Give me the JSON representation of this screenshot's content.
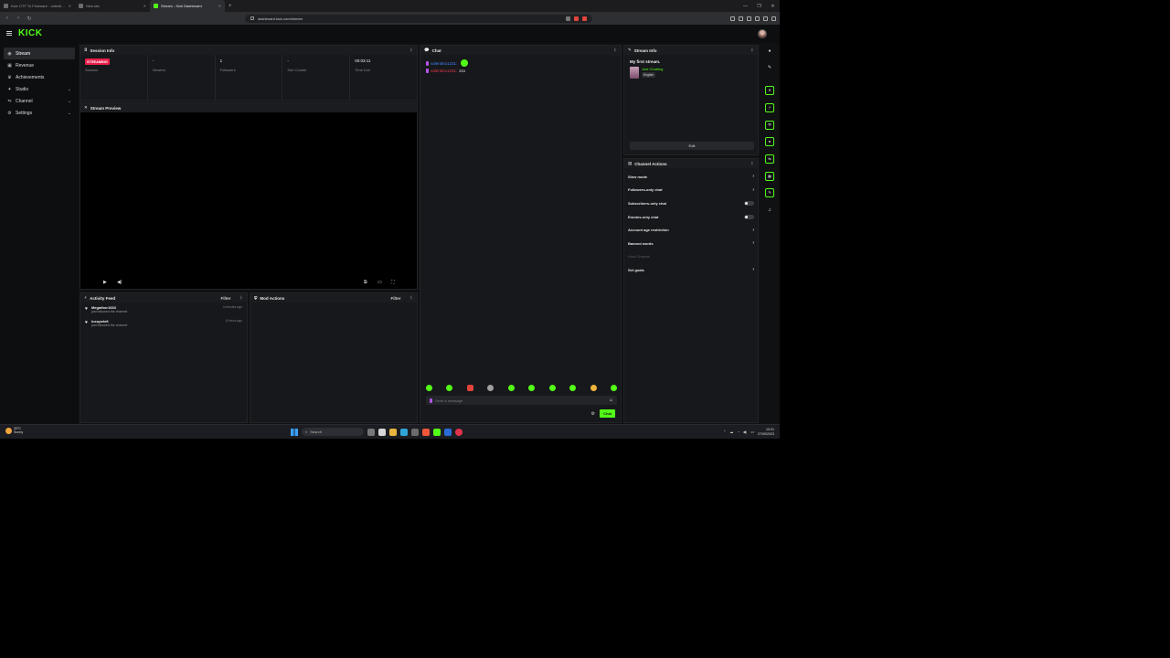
{
  "browser": {
    "tabs": [
      {
        "label": "Kwe OTF To Firmware - valentin..."
      },
      {
        "label": "New tab"
      },
      {
        "label": "Stream - Kick Dashboard",
        "active": true
      }
    ],
    "url": "dashboard.kick.com/stream"
  },
  "app": {
    "logo": "KICK"
  },
  "sidebar": {
    "items": [
      {
        "label": "Stream",
        "icon": "signal-icon",
        "active": true
      },
      {
        "label": "Revenue",
        "icon": "wallet-icon"
      },
      {
        "label": "Achievements",
        "icon": "trophy-icon"
      },
      {
        "label": "Studio",
        "icon": "studio-icon",
        "expandable": true
      },
      {
        "label": "Channel",
        "icon": "channel-icon",
        "expandable": true
      },
      {
        "label": "Settings",
        "icon": "gear-icon",
        "expandable": true
      }
    ]
  },
  "session": {
    "title": "Session Info",
    "badge": "STREAMING",
    "cells": [
      {
        "value": "",
        "label": "Session"
      },
      {
        "value": "-",
        "label": "Viewers"
      },
      {
        "value": "1",
        "label": "Followers"
      },
      {
        "value": "-",
        "label": "Sub Counts"
      },
      {
        "value": "00:03:11",
        "label": "Time Live"
      }
    ]
  },
  "preview": {
    "title": "Stream Preview"
  },
  "activity": {
    "title": "Activity Feed",
    "filter": "Filter",
    "items": [
      {
        "name": "Megathor1633",
        "desc": "just followed the channel",
        "time": "4 minutes ago"
      },
      {
        "name": "luxupete6",
        "desc": "just followed the channel",
        "time": "8 hours ago"
      }
    ]
  },
  "mod": {
    "title": "Mod Actions",
    "filter": "Filter"
  },
  "chat": {
    "title": "Chat",
    "messages": [
      {
        "user": "valentino1231:",
        "text": ""
      },
      {
        "user": "valentino1231:",
        "text": "zzx"
      }
    ],
    "input_placeholder": "Send a message",
    "send": "Chat"
  },
  "stream_info": {
    "title": "Stream Info",
    "stream_title": "My first stream.",
    "category": "Just Chatting",
    "tag": "English",
    "edit": "Edit"
  },
  "channel_actions": {
    "title": "Channel Actions",
    "items": [
      {
        "label": "Slow mode",
        "control": "arrow"
      },
      {
        "label": "Followers-only chat",
        "control": "arrow"
      },
      {
        "label": "Subscribers-only chat",
        "control": "toggle"
      },
      {
        "label": "Emotes-only chat",
        "control": "toggle"
      },
      {
        "label": "Account age restriction",
        "control": "arrow"
      },
      {
        "label": "Banned words",
        "control": "arrow"
      },
      {
        "label": "Host Channel",
        "control": "none",
        "dim": true
      },
      {
        "label": "Set goals",
        "control": "arrow"
      }
    ]
  },
  "taskbar": {
    "weather_temp": "30°C",
    "weather_desc": "Sunny",
    "search": "Search",
    "time": "10:01",
    "date": "27/09/2023"
  },
  "colors": {
    "accent": "#53fc18",
    "streaming": "#e91e4a",
    "background": "#101113"
  }
}
